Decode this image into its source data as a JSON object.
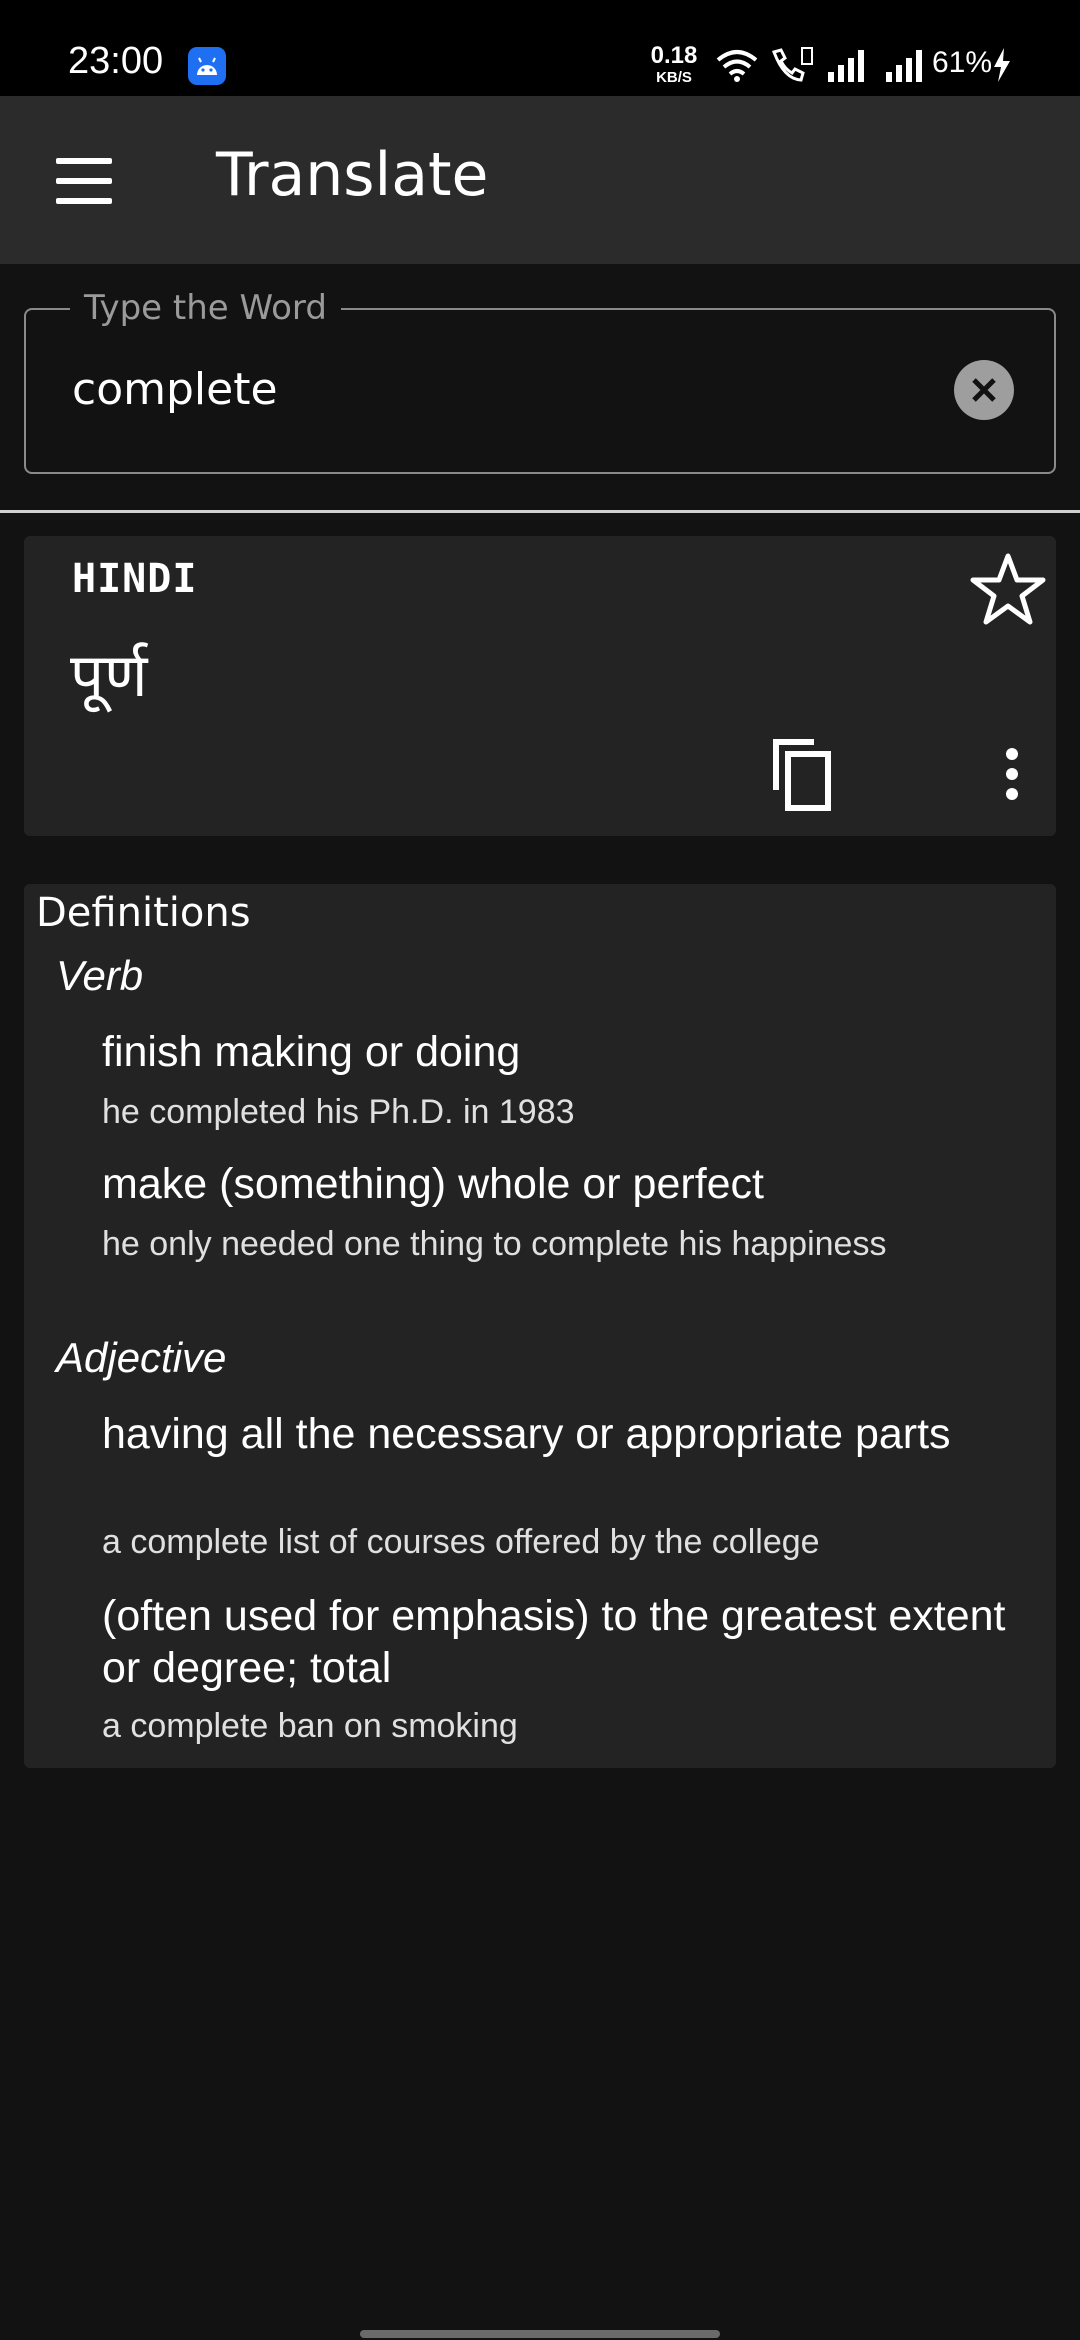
{
  "status_bar": {
    "time": "23:00",
    "speed_value": "0.18",
    "speed_unit": "KB/S",
    "battery": "61%",
    "icons": [
      "android-app-icon",
      "wifi-icon",
      "call-icon",
      "signal-icon",
      "battery-charging-icon"
    ]
  },
  "app_bar": {
    "title": "Translate"
  },
  "search": {
    "label": "Type the Word",
    "value": "complete"
  },
  "translation": {
    "language": "HINDI",
    "text": "पूर्ण"
  },
  "definitions": {
    "title": "Definitions",
    "groups": [
      {
        "pos": "Verb",
        "entries": [
          {
            "meaning": "finish making or doing",
            "example": "he completed his Ph.D. in 1983"
          },
          {
            "meaning": "make (something) whole or perfect",
            "example": "he only needed one thing to complete his happiness"
          }
        ]
      },
      {
        "pos": "Adjective",
        "entries": [
          {
            "meaning": "having all the necessary or appropriate parts",
            "example": "a complete list of courses offered by the college"
          },
          {
            "meaning": "(often used for emphasis) to the greatest extent or degree; total",
            "example": "a complete ban on smoking"
          }
        ]
      }
    ]
  },
  "colors": {
    "background": "#121212",
    "app_bar": "#2b2b2b",
    "card": "#232323",
    "status_app_icon": "#1e6ff2"
  }
}
